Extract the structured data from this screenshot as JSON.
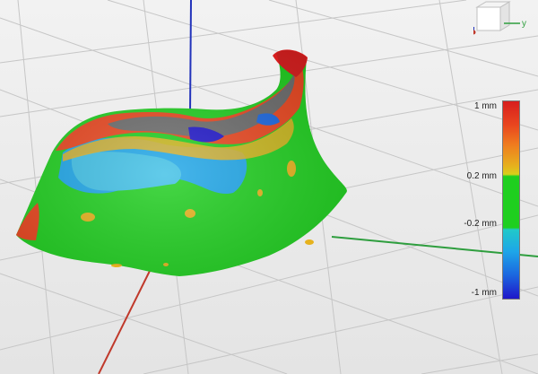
{
  "legend": {
    "labels": [
      "1 mm",
      "0.2 mm",
      "-0.2 mm",
      "-1 mm"
    ],
    "colors": {
      "high": "#d81e1e",
      "upper_mid": "#e6b21d",
      "tolerance": "#1fcf1f",
      "lower_mid": "#1ea6e8",
      "low": "#1f16c9"
    }
  },
  "view_cube": {
    "axis_y_label": "y",
    "icon": "view-cube-icon"
  },
  "scene": {
    "axis_colors": {
      "x": "#c0392b",
      "y": "#2e9e3e",
      "z": "#2233bb"
    },
    "grid_color": "#c6c6c6",
    "background": "#ececec"
  }
}
